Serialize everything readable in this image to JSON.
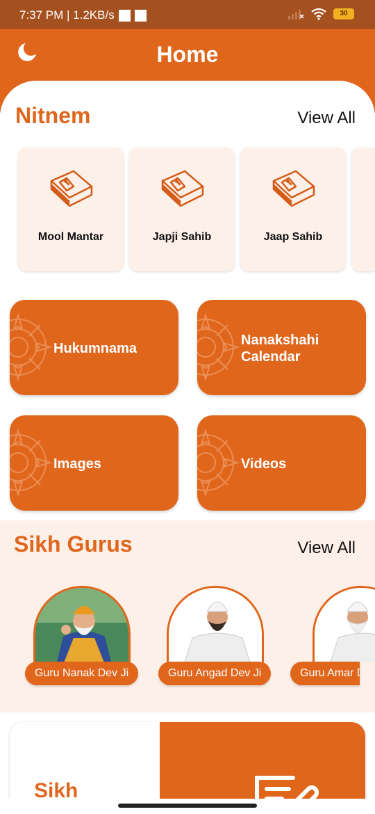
{
  "status": {
    "time_speed": "7:37 PM | 1.2KB/s",
    "battery": "30"
  },
  "appbar": {
    "title": "Home",
    "theme_icon": "moon-icon"
  },
  "nitnem": {
    "title": "Nitnem",
    "view_all": "View All",
    "items": [
      {
        "label": "Mool Mantar",
        "icon": "book-icon"
      },
      {
        "label": "Japji Sahib",
        "icon": "book-icon"
      },
      {
        "label": "Jaap Sahib",
        "icon": "book-icon"
      }
    ]
  },
  "tiles": [
    {
      "label": "Hukumnama"
    },
    {
      "label": "Nanakshahi\nCalendar"
    },
    {
      "label": "Images"
    },
    {
      "label": "Videos"
    }
  ],
  "gurus": {
    "title": "Sikh Gurus",
    "view_all": "View All",
    "items": [
      {
        "name": "Guru Nanak Dev Ji"
      },
      {
        "name": "Guru Angad Dev Ji"
      },
      {
        "name": "Guru Amar Das Ji"
      }
    ]
  },
  "bottom_card": {
    "title": "Sikh",
    "icon": "note-edit-icon"
  },
  "colors": {
    "accent": "#e0661c",
    "status_bar": "#a4501f",
    "card_bg": "#fdf0e8"
  }
}
